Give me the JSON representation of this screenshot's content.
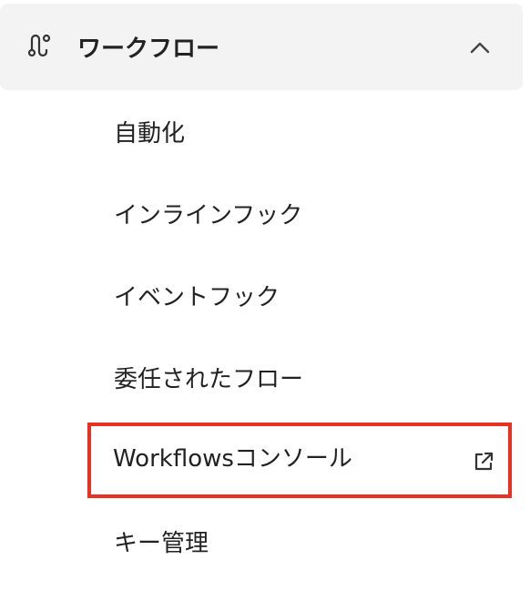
{
  "section": {
    "title": "ワークフロー",
    "icon": "workflow-icon",
    "toggle_icon": "chevron-up-icon",
    "expanded": true
  },
  "menu": {
    "items": [
      {
        "label": "自動化"
      },
      {
        "label": "インラインフック"
      },
      {
        "label": "イベントフック"
      },
      {
        "label": "委任されたフロー"
      },
      {
        "label": "Workflowsコンソール",
        "icon": "external-link-icon"
      },
      {
        "label": "キー管理"
      }
    ]
  },
  "colors": {
    "header_background": "#f3f3f3",
    "highlight_border": "#e8311f",
    "text": "#222222"
  }
}
